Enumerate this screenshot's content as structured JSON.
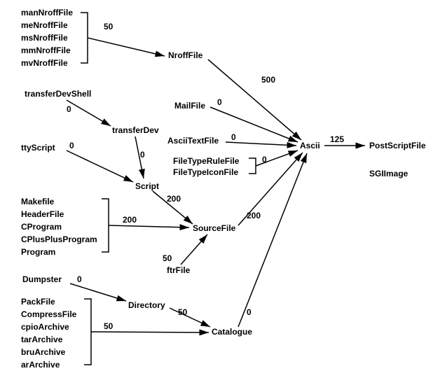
{
  "nodes": {
    "manNroffFile": "manNroffFile",
    "meNroffFile": "meNroffFile",
    "msNroffFile": "msNroffFile",
    "mmNroffFile": "mmNroffFile",
    "mvNroffFile": "mvNroffFile",
    "NroffFile": "NroffFile",
    "transferDevShell": "transferDevShell",
    "transferDev": "transferDev",
    "ttyScript": "ttyScript",
    "Script": "Script",
    "Makefile": "Makefile",
    "HeaderFile": "HeaderFile",
    "CProgram": "CProgram",
    "CPlusPlusProgram": "CPlusPlusProgram",
    "Program": "Program",
    "SourceFile": "SourceFile",
    "ftrFile": "ftrFile",
    "MailFile": "MailFile",
    "AsciiTextFile": "AsciiTextFile",
    "FileTypeRuleFile": "FileTypeRuleFile",
    "FileTypeIconFile": "FileTypeIconFile",
    "Ascii": "Ascii",
    "PostScriptFile": "PostScriptFile",
    "SGIImage": "SGIImage",
    "Dumpster": "Dumpster",
    "Directory": "Directory",
    "PackFile": "PackFile",
    "CompressFile": "CompressFile",
    "cpioArchive": "cpioArchive",
    "tarArchive": "tarArchive",
    "bruArchive": "bruArchive",
    "arArchive": "arArchive",
    "Catalogue": "Catalogue"
  },
  "edge_weights": {
    "nroffGroup_to_NroffFile": "50",
    "NroffFile_to_Ascii": "500",
    "MailFile_to_Ascii": "0",
    "transferDevShell_to_transferDev": "0",
    "transferDev_to_Script": "0",
    "ttyScript_to_Script": "0",
    "Script_to_SourceFile": "200",
    "progGroup_to_SourceFile": "200",
    "ftrFile_to_SourceFile": "50",
    "SourceFile_to_Ascii": "200",
    "AsciiTextFile_to_Ascii": "0",
    "FileTypeGroup_to_Ascii": "0",
    "Ascii_to_PostScriptFile": "125",
    "Dumpster_to_Directory": "0",
    "archiveGroup_to_Catalogue": "50",
    "Directory_to_Catalogue": "50",
    "Catalogue_to_Ascii": "0"
  }
}
